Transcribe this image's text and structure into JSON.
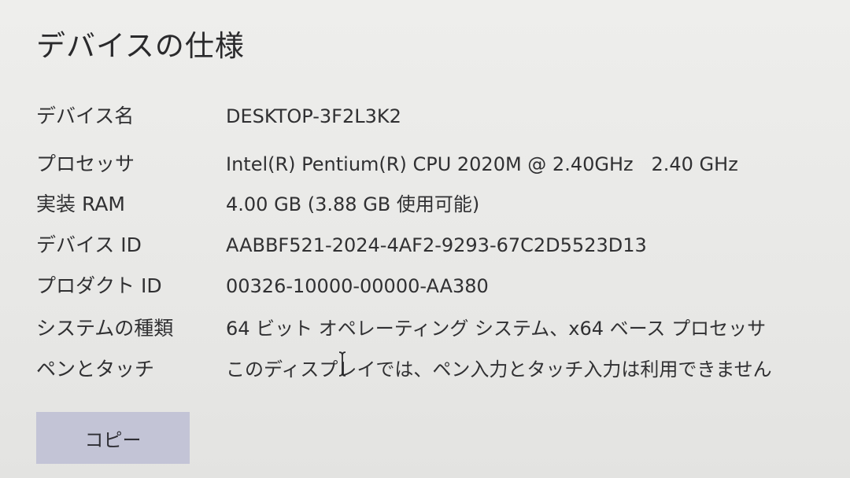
{
  "section": {
    "title": "デバイスの仕様"
  },
  "specs": [
    {
      "label": "デバイス名",
      "value": "DESKTOP-3F2L3K2"
    },
    {
      "label": "プロセッサ",
      "value": "Intel(R) Pentium(R) CPU 2020M @ 2.40GHz   2.40 GHz"
    },
    {
      "label": "実装 RAM",
      "value": "4.00 GB (3.88 GB 使用可能)"
    },
    {
      "label": "デバイス ID",
      "value": "AABBF521-2024-4AF2-9293-67C2D5523D13"
    },
    {
      "label": "プロダクト ID",
      "value": "00326-10000-00000-AA380"
    },
    {
      "label": "システムの種類",
      "value": "64 ビット オペレーティング システム、x64 ベース プロセッサ"
    },
    {
      "label": "ペンとタッチ",
      "value": "このディスプレイでは、ペン入力とタッチ入力は利用できません"
    }
  ],
  "actions": {
    "copy_label": "コピー"
  },
  "icons": {
    "cursor": "text-cursor-icon"
  }
}
